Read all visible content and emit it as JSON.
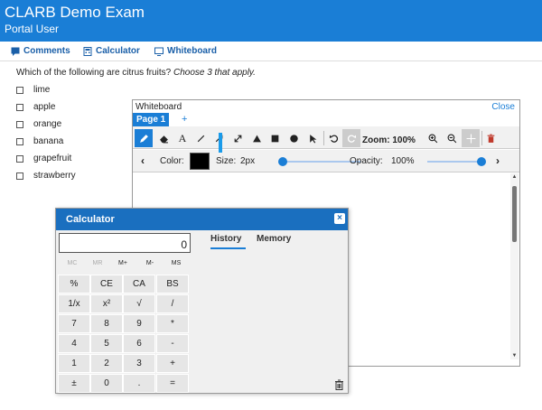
{
  "app": {
    "title": "CLARB Demo Exam",
    "subtitle": "Portal User"
  },
  "toolbar": {
    "comments": "Comments",
    "calculator": "Calculator",
    "whiteboard": "Whiteboard"
  },
  "question": {
    "text": "Which of the following are citrus fruits?",
    "instruction": "Choose 3 that apply.",
    "options": [
      "lime",
      "apple",
      "orange",
      "banana",
      "grapefruit",
      "strawberry"
    ]
  },
  "whiteboard": {
    "title": "Whiteboard",
    "close": "Close",
    "page_tab": "Page 1",
    "add_page": "+",
    "tool_text": "A",
    "zoom_text": "Zoom: 100%",
    "color_label": "Color:",
    "color_value": "#000000",
    "size_label": "Size:",
    "size_value": "2px",
    "opacity_label": "Opacity:",
    "opacity_value": "100%",
    "size_level": 0.0,
    "opacity_level": 1.0
  },
  "calculator": {
    "title": "Calculator",
    "close": "×",
    "display": "0",
    "memory_keys": [
      "MC",
      "MR",
      "M+",
      "M-",
      "MS"
    ],
    "keys": [
      [
        "%",
        "CE",
        "CA",
        "BS"
      ],
      [
        "1/x",
        "x²",
        "√",
        "/"
      ],
      [
        "7",
        "8",
        "9",
        "*"
      ],
      [
        "4",
        "5",
        "6",
        "-"
      ],
      [
        "1",
        "2",
        "3",
        "+"
      ],
      [
        "±",
        "0",
        ".",
        "="
      ]
    ],
    "tabs": {
      "history": "History",
      "memory": "Memory"
    }
  },
  "colors": {
    "header": "#1a7ed6",
    "calc_header": "#1a6fbf",
    "accent": "#1a7ed6"
  }
}
